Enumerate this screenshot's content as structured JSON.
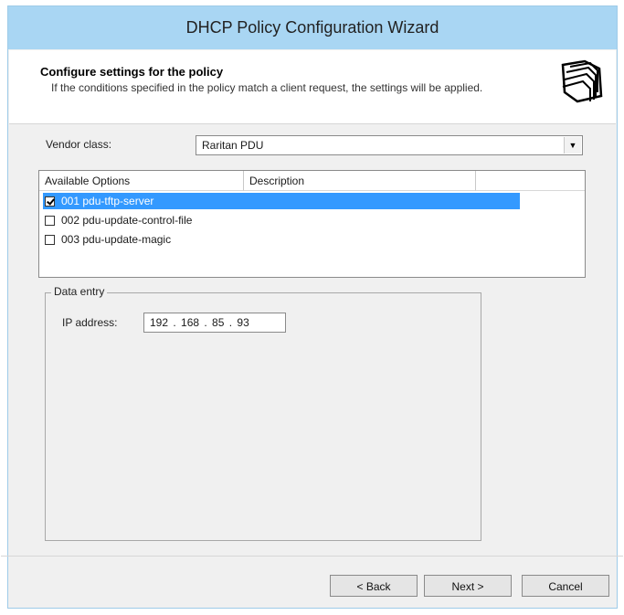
{
  "window": {
    "title": "DHCP Policy Configuration Wizard"
  },
  "header": {
    "title": "Configure settings for the policy",
    "subtitle": "If the conditions specified in the policy match a client request, the settings will be applied.",
    "icon": "folders-icon"
  },
  "vendor": {
    "label": "Vendor class:",
    "value": "Raritan PDU"
  },
  "options": {
    "columns": [
      "Available Options",
      "Description"
    ],
    "items": [
      {
        "label": "001 pdu-tftp-server",
        "checked": true,
        "selected": true
      },
      {
        "label": "002 pdu-update-control-file",
        "checked": false,
        "selected": false
      },
      {
        "label": "003 pdu-update-magic",
        "checked": false,
        "selected": false
      }
    ]
  },
  "data_entry": {
    "legend": "Data entry",
    "ip_label": "IP address:",
    "ip_value": "192 . 168 .  85  .  93"
  },
  "buttons": {
    "back": "< Back",
    "next": "Next >",
    "cancel": "Cancel"
  },
  "colors": {
    "titlebar": "#a9d6f3",
    "selection": "#3399ff",
    "dialog_bg": "#f0f0f0"
  }
}
